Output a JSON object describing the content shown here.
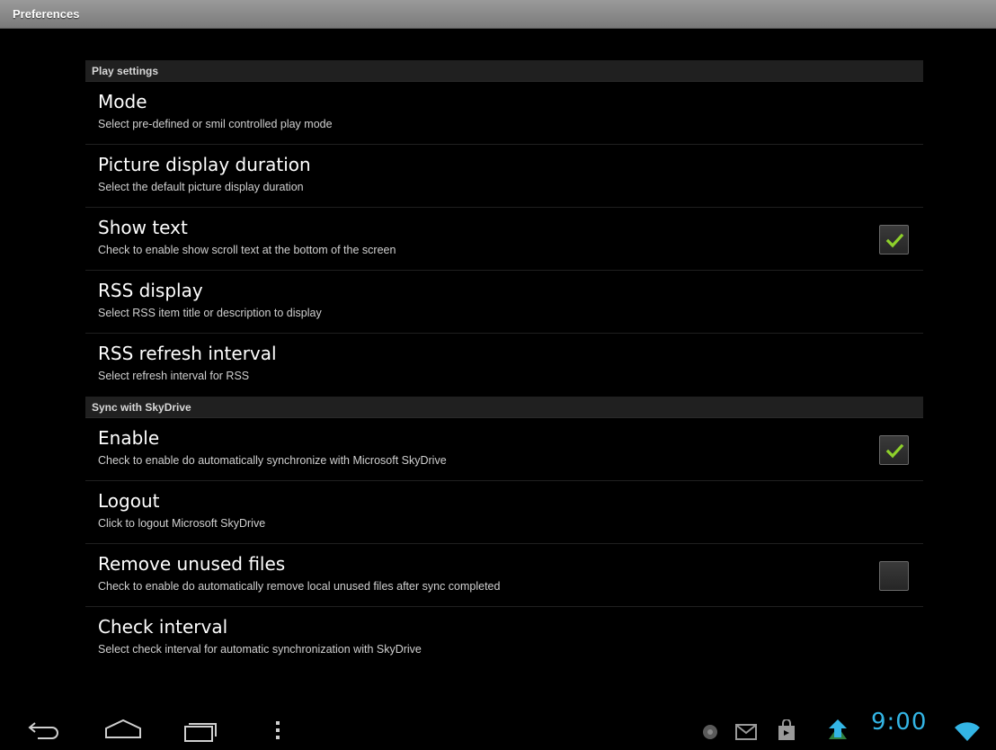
{
  "window": {
    "title": "Preferences"
  },
  "categories": [
    {
      "label": "Play settings",
      "items": [
        {
          "title": "Mode",
          "summary": "Select pre-defined or smil controlled play mode"
        },
        {
          "title": "Picture display duration",
          "summary": "Select the default picture display duration"
        },
        {
          "title": "Show text",
          "summary": "Check to enable show scroll text at the bottom of the screen",
          "checkbox": true,
          "checked": true
        },
        {
          "title": "RSS display",
          "summary": "Select RSS item title or description to display"
        },
        {
          "title": "RSS refresh interval",
          "summary": "Select refresh interval for RSS"
        }
      ]
    },
    {
      "label": "Sync with SkyDrive",
      "items": [
        {
          "title": "Enable",
          "summary": "Check to enable do automatically synchronize with Microsoft SkyDrive",
          "checkbox": true,
          "checked": true
        },
        {
          "title": "Logout",
          "summary": "Click to logout Microsoft SkyDrive"
        },
        {
          "title": "Remove unused files",
          "summary": "Check to enable do automatically remove local unused files after sync completed",
          "checkbox": true,
          "checked": false
        },
        {
          "title": "Check interval",
          "summary": "Select check interval for automatic synchronization with SkyDrive"
        }
      ]
    }
  ],
  "navbar": {
    "buttons": [
      "back-icon",
      "home-icon",
      "recent-apps-icon",
      "menu-icon"
    ],
    "status_icons": [
      "notification-dot-icon",
      "gmail-icon",
      "market-icon",
      "upload-icon",
      "wifi-icon"
    ],
    "clock": "9:00"
  },
  "colors": {
    "accent": "#33b5e5",
    "check": "#8ed12b",
    "category_bg": "#202020",
    "titlebar": "#8a8a8a"
  }
}
